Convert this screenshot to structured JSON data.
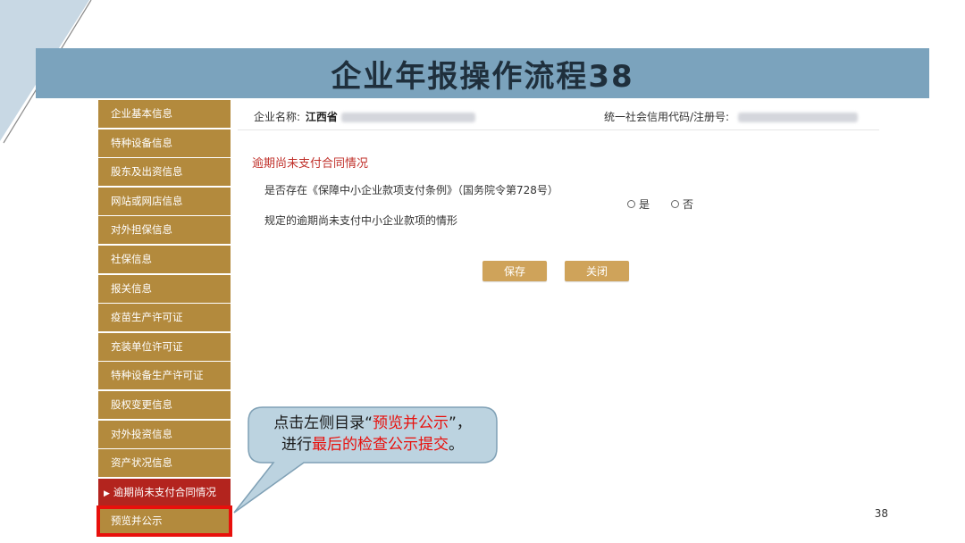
{
  "slide_title": "企业年报操作流程38",
  "sidebar": {
    "items": [
      {
        "label": "企业基本信息"
      },
      {
        "label": "特种设备信息"
      },
      {
        "label": "股东及出资信息"
      },
      {
        "label": "网站或网店信息"
      },
      {
        "label": "对外担保信息"
      },
      {
        "label": "社保信息"
      },
      {
        "label": "报关信息"
      },
      {
        "label": "疫苗生产许可证"
      },
      {
        "label": "充装单位许可证"
      },
      {
        "label": "特种设备生产许可证"
      },
      {
        "label": "股权变更信息"
      },
      {
        "label": "对外投资信息"
      },
      {
        "label": "资产状况信息"
      },
      {
        "label": "逾期尚未支付合同情况"
      },
      {
        "label": "预览并公示"
      }
    ],
    "active_index": 13,
    "highlight_index": 14
  },
  "header": {
    "company_label": "企业名称:",
    "company_value": "江西省",
    "credit_label": "统一社会信用代码/注册号:"
  },
  "form": {
    "section_title": "逾期尚未支付合同情况",
    "question_line1": "是否存在《保障中小企业款项支付条例》（国务院令第728号）",
    "question_line2": "规定的逾期尚未支付中小企业款项的情形",
    "options": [
      "是",
      "否"
    ],
    "save_label": "保存",
    "close_label": "关闭"
  },
  "callout": {
    "line1_prefix": "点击左侧目录“",
    "line1_highlight": "预览并公示",
    "line1_suffix": "”，",
    "line2_prefix": "进行",
    "line2_highlight": "最后的检查公示提交",
    "line2_suffix": "。"
  },
  "page_number": "38",
  "colors": {
    "title_bar": "#7ba3bd",
    "sidebar_item": "#b38a3d",
    "sidebar_active": "#b3241e",
    "highlight": "#e8100c",
    "button": "#cfa35a",
    "section_title": "#c0302a"
  }
}
